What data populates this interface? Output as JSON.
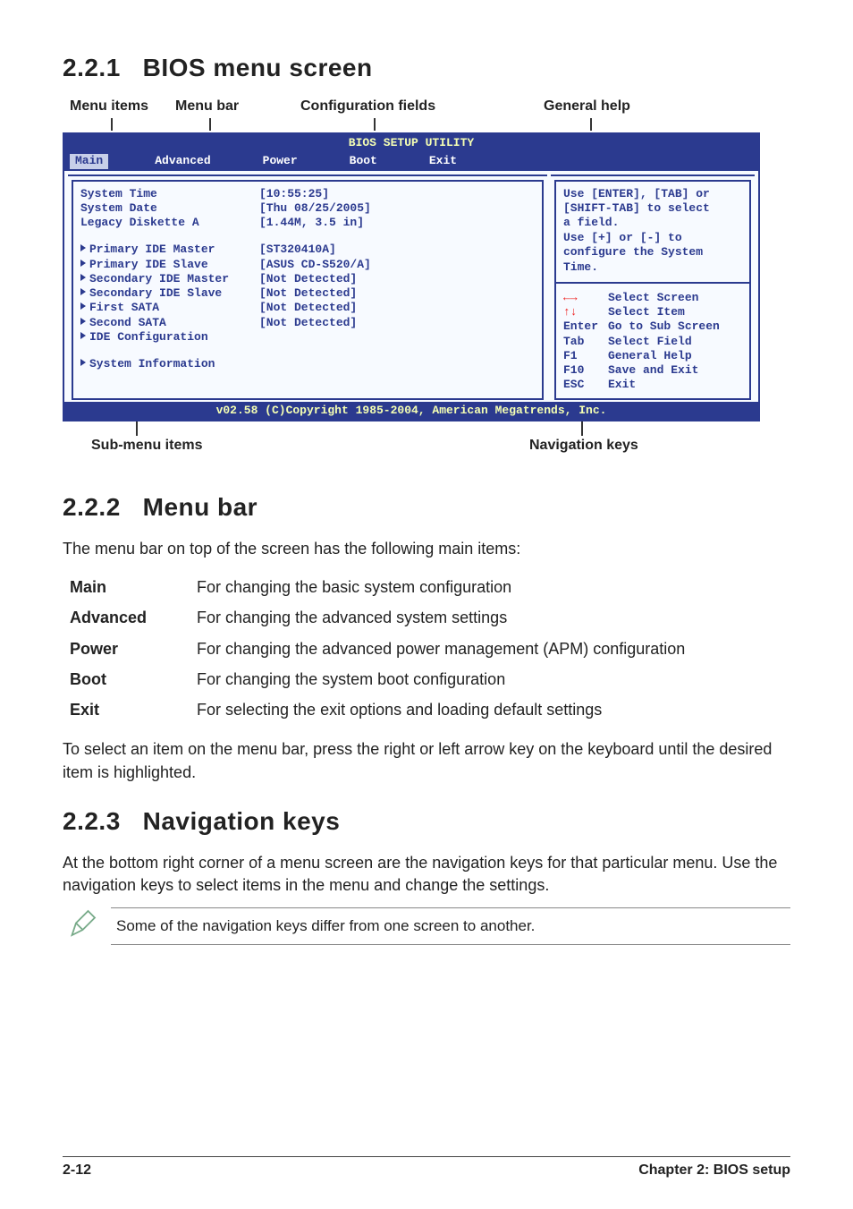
{
  "sections": {
    "s1": {
      "num": "2.2.1",
      "title": "BIOS menu screen"
    },
    "s2": {
      "num": "2.2.2",
      "title": "Menu bar"
    },
    "s3": {
      "num": "2.2.3",
      "title": "Navigation keys"
    }
  },
  "top_labels": {
    "menu_items": "Menu items",
    "menu_bar": "Menu bar",
    "config_fields": "Configuration fields",
    "general_help": "General help"
  },
  "under_labels": {
    "submenu": "Sub-menu items",
    "navkeys": "Navigation keys"
  },
  "bios": {
    "title": "BIOS SETUP UTILITY",
    "menu": {
      "main": "Main",
      "advanced": "Advanced",
      "power": "Power",
      "boot": "Boot",
      "exit": "Exit"
    },
    "rows": {
      "system_time": "System Time",
      "system_time_v": "[10:55:25]",
      "system_date": "System Date",
      "system_date_v": "[Thu 08/25/2005]",
      "legacy_a": "Legacy Diskette A",
      "legacy_a_v": "[1.44M, 3.5 in]",
      "pim": "Primary IDE Master",
      "pim_v": "[ST320410A]",
      "pis": "Primary IDE Slave",
      "pis_v": "[ASUS CD-S520/A]",
      "sim": "Secondary IDE Master",
      "sim_v": "[Not Detected]",
      "sis": "Secondary IDE Slave",
      "sis_v": "[Not Detected]",
      "fsata": "First SATA",
      "fsata_v": "[Not Detected]",
      "ssata": "Second SATA",
      "ssata_v": "[Not Detected]",
      "idecfg": "IDE Configuration",
      "sysinfo": "System Information"
    },
    "help": {
      "ln1": "Use [ENTER], [TAB] or",
      "ln2": "[SHIFT-TAB] to select",
      "ln3": "a field.",
      "ln4": "Use [+] or [-] to",
      "ln5": "configure the System",
      "ln6": "Time."
    },
    "nav": {
      "lr": "Select Screen",
      "ud": "Select Item",
      "enter_k": "Enter",
      "enter_t": "Go to Sub Screen",
      "tab_k": "Tab",
      "tab_t": "Select Field",
      "f1_k": "F1",
      "f1_t": "General Help",
      "f10_k": "F10",
      "f10_t": "Save and Exit",
      "esc_k": "ESC",
      "esc_t": "Exit"
    },
    "footer": "v02.58 (C)Copyright 1985-2004, American Megatrends, Inc."
  },
  "menu_bar_intro": "The menu bar on top of the screen has the following main items:",
  "menu_bar_table": {
    "main": {
      "term": "Main",
      "desc": "For changing the basic system configuration"
    },
    "advanced": {
      "term": "Advanced",
      "desc": "For changing the advanced system settings"
    },
    "power": {
      "term": "Power",
      "desc": "For changing the advanced power management (APM) configuration"
    },
    "boot": {
      "term": "Boot",
      "desc": "For changing the system boot configuration"
    },
    "exit": {
      "term": "Exit",
      "desc": "For selecting the exit options and loading default settings"
    }
  },
  "menu_bar_outro": "To select an item on the menu bar, press the right or left arrow key on the keyboard until the desired item is highlighted.",
  "navkeys_para": "At the bottom right corner of a menu screen are the navigation keys for that particular menu. Use the navigation keys to select items in the menu and change the settings.",
  "note": "Some of the navigation keys differ from one screen to another.",
  "footer": {
    "left": "2-12",
    "right": "Chapter 2: BIOS setup"
  }
}
